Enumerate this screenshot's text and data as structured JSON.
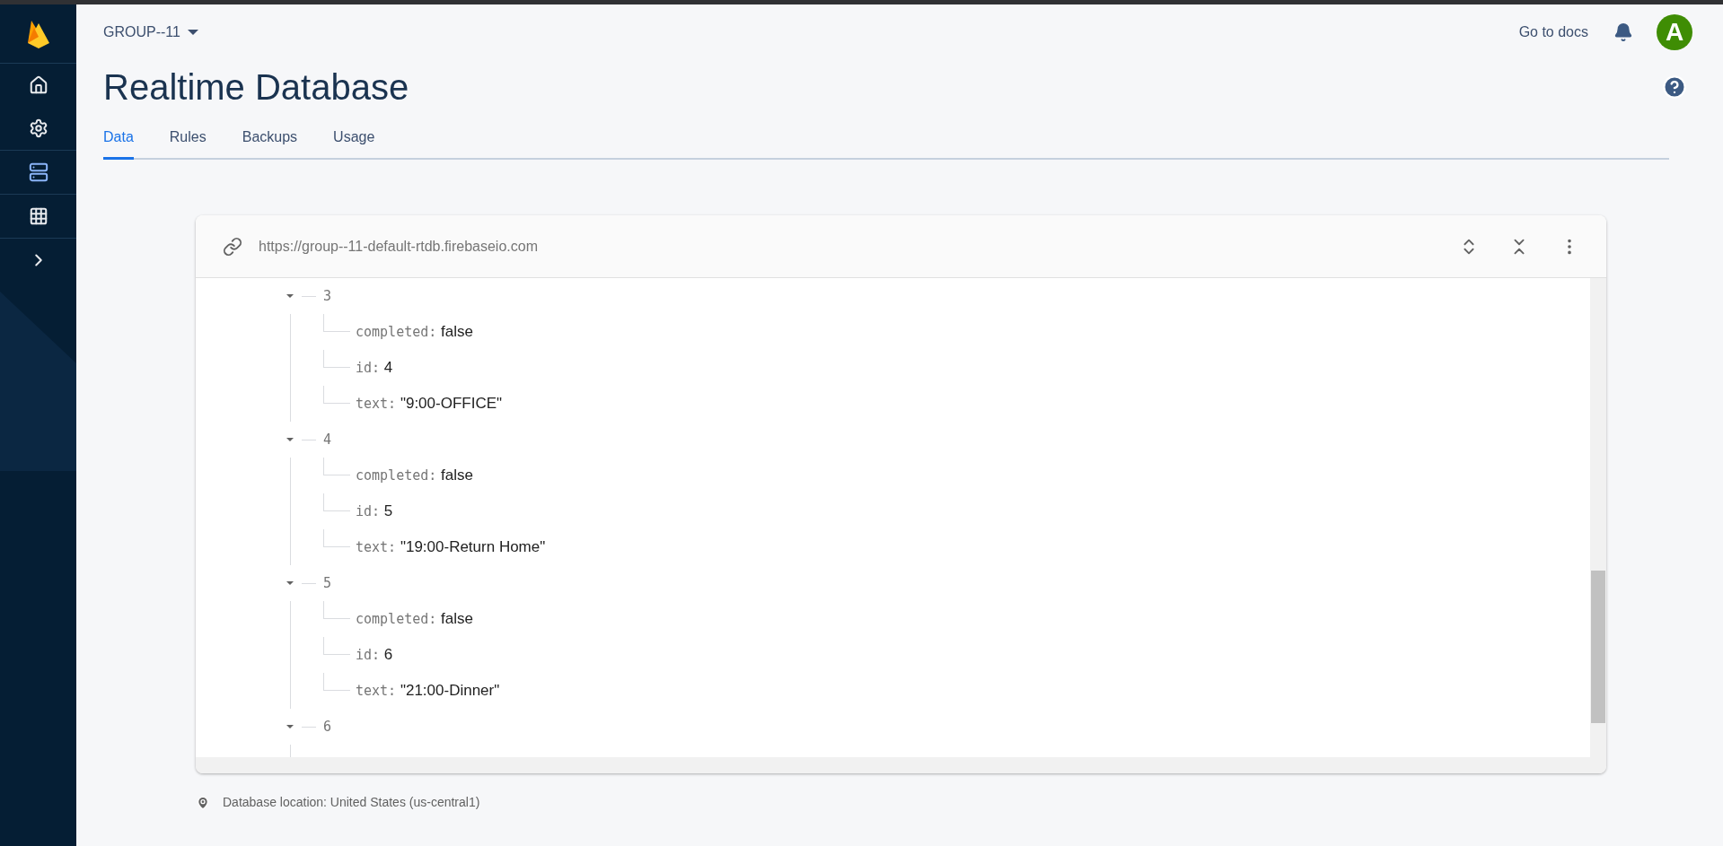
{
  "sidebar": {
    "items": [
      {
        "kind": "home",
        "selected": false
      },
      {
        "kind": "settings",
        "selected": false
      },
      {
        "kind": "database",
        "selected": true
      },
      {
        "kind": "apps",
        "selected": false
      },
      {
        "kind": "expand",
        "selected": false
      }
    ]
  },
  "header": {
    "project": "GROUP--11",
    "docs_link": "Go to docs",
    "avatar_letter": "A",
    "title": "Realtime Database"
  },
  "tabs": [
    {
      "label": "Data",
      "selected": true
    },
    {
      "label": "Rules",
      "selected": false
    },
    {
      "label": "Backups",
      "selected": false
    },
    {
      "label": "Usage",
      "selected": false
    }
  ],
  "database": {
    "url": "https://group--11-default-rtdb.firebaseio.com",
    "nodes": [
      {
        "key": "3",
        "expanded": true,
        "children": [
          {
            "key": "completed:",
            "value": "false"
          },
          {
            "key": "id:",
            "value": "4"
          },
          {
            "key": "text:",
            "value": "\"9:00-OFFICE\""
          }
        ]
      },
      {
        "key": "4",
        "expanded": true,
        "children": [
          {
            "key": "completed:",
            "value": "false"
          },
          {
            "key": "id:",
            "value": "5"
          },
          {
            "key": "text:",
            "value": "\"19:00-Return Home\""
          }
        ]
      },
      {
        "key": "5",
        "expanded": true,
        "children": [
          {
            "key": "completed:",
            "value": "false"
          },
          {
            "key": "id:",
            "value": "6"
          },
          {
            "key": "text:",
            "value": "\"21:00-Dinner\""
          }
        ]
      },
      {
        "key": "6",
        "expanded": true
      }
    ]
  },
  "footer": {
    "location": "Database location: United States (us-central1)"
  }
}
